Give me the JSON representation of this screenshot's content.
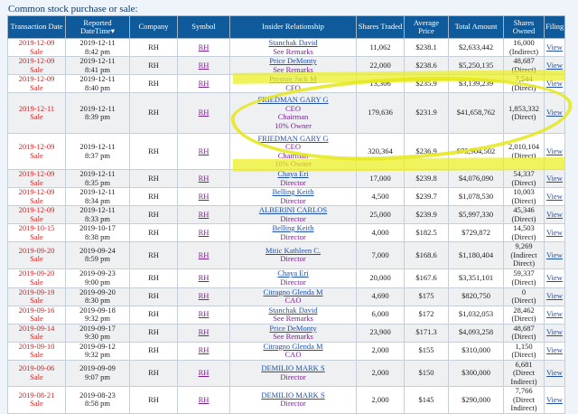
{
  "caption": "Common stock purchase or sale:",
  "headers": [
    "Transaction Date",
    "Reported DateTime▾",
    "Company",
    "Symbol",
    "Insider Relationship",
    "Shares Traded",
    "Average Price",
    "Total Amount",
    "Shares Owned",
    "Filing"
  ],
  "rows": [
    {
      "tdate": "2019-12-09",
      "ttype": "Sale",
      "rdate": "2019-12-11",
      "rtime": "8:42 pm",
      "company": "RH",
      "symbol": "RH",
      "insider": "Stanchak David",
      "roles": [
        "See Remarks"
      ],
      "shares": "11,062",
      "price": "$238.1",
      "total": "$2,633,442",
      "owned": [
        "16,000",
        "(Indirect)"
      ],
      "filing": "View"
    },
    {
      "tdate": "2019-12-09",
      "ttype": "Sale",
      "rdate": "2019-12-11",
      "rtime": "8:41 pm",
      "company": "RH",
      "symbol": "RH",
      "insider": "Price DeMonty",
      "roles": [
        "See Remarks"
      ],
      "shares": "22,000",
      "price": "$238.6",
      "total": "$5,250,135",
      "owned": [
        "48,687",
        "(Direct)"
      ],
      "filing": "View"
    },
    {
      "tdate": "2019-12-09",
      "ttype": "Sale",
      "rdate": "2019-12-11",
      "rtime": "8:40 pm",
      "company": "RH",
      "symbol": "RH",
      "insider": "Preston Jack M",
      "roles": [
        "CFO"
      ],
      "shares": "13,306",
      "price": "$235.9",
      "total": "$3,139,239",
      "owned": [
        "7,544",
        "(Direct)"
      ],
      "filing": "View"
    },
    {
      "tdate": "2019-12-11",
      "ttype": "Sale",
      "rdate": "2019-12-11",
      "rtime": "8:39 pm",
      "company": "RH",
      "symbol": "RH",
      "insider": "FRIEDMAN GARY G",
      "roles": [
        "CEO",
        "Chairman",
        "10% Owner"
      ],
      "shares": "179,636",
      "price": "$231.9",
      "total": "$41,658,762",
      "owned": [
        "1,853,332",
        "(Direct)"
      ],
      "filing": "View"
    },
    {
      "tdate": "2019-12-09",
      "ttype": "Sale",
      "rdate": "2019-12-11",
      "rtime": "8:37 pm",
      "company": "RH",
      "symbol": "RH",
      "insider": "FRIEDMAN GARY G",
      "roles": [
        "CEO",
        "Chairman",
        "10% Owner"
      ],
      "shares": "320,364",
      "price": "$236.9",
      "total": "$75,904,502",
      "owned": [
        "2,010,104",
        "(Direct)"
      ],
      "filing": "View"
    },
    {
      "tdate": "2019-12-09",
      "ttype": "Sale",
      "rdate": "2019-12-11",
      "rtime": "8:35 pm",
      "company": "RH",
      "symbol": "RH",
      "insider": "Chaya Eri",
      "roles": [
        "Director"
      ],
      "shares": "17,000",
      "price": "$239.8",
      "total": "$4,076,090",
      "owned": [
        "54,337",
        "(Direct)"
      ],
      "filing": "View"
    },
    {
      "tdate": "2019-12-09",
      "ttype": "Sale",
      "rdate": "2019-12-11",
      "rtime": "8:34 pm",
      "company": "RH",
      "symbol": "RH",
      "insider": "Belling Keith",
      "roles": [
        "Director"
      ],
      "shares": "4,500",
      "price": "$239.7",
      "total": "$1,078,530",
      "owned": [
        "10,003",
        "(Direct)"
      ],
      "filing": "View"
    },
    {
      "tdate": "2019-12-09",
      "ttype": "Sale",
      "rdate": "2019-12-11",
      "rtime": "8:33 pm",
      "company": "RH",
      "symbol": "RH",
      "insider": "ALBERINI CARLOS",
      "roles": [
        "Director"
      ],
      "shares": "25,000",
      "price": "$239.9",
      "total": "$5,997,330",
      "owned": [
        "45,346",
        "(Direct)"
      ],
      "filing": "View"
    },
    {
      "tdate": "2019-10-15",
      "ttype": "Sale",
      "rdate": "2019-10-17",
      "rtime": "8:38 pm",
      "company": "RH",
      "symbol": "RH",
      "insider": "Belling Keith",
      "roles": [
        "Director"
      ],
      "shares": "4,000",
      "price": "$182.5",
      "total": "$729,872",
      "owned": [
        "14,503",
        "(Direct)"
      ],
      "filing": "View"
    },
    {
      "tdate": "2019-09-20",
      "ttype": "Sale",
      "rdate": "2019-09-24",
      "rtime": "8:59 pm",
      "company": "RH",
      "symbol": "RH",
      "insider": "Mitic Kathleen C.",
      "roles": [
        "Director"
      ],
      "shares": "7,000",
      "price": "$168.6",
      "total": "$1,180,404",
      "owned": [
        "9,269",
        "(Indirect",
        "Direct)"
      ],
      "filing": "View"
    },
    {
      "tdate": "2019-09-20",
      "ttype": "Sale",
      "rdate": "2019-09-23",
      "rtime": "9:00 pm",
      "company": "RH",
      "symbol": "RH",
      "insider": "Chaya Eri",
      "roles": [
        "Director"
      ],
      "shares": "20,000",
      "price": "$167.6",
      "total": "$3,351,101",
      "owned": [
        "59,337",
        "(Direct)"
      ],
      "filing": "View"
    },
    {
      "tdate": "2019-09-19",
      "ttype": "Sale",
      "rdate": "2019-09-20",
      "rtime": "8:30 pm",
      "company": "RH",
      "symbol": "RH",
      "insider": "Citragno Glenda M",
      "roles": [
        "CAO"
      ],
      "shares": "4,690",
      "price": "$175",
      "total": "$820,750",
      "owned": [
        "0",
        "(Direct)"
      ],
      "filing": "View"
    },
    {
      "tdate": "2019-09-16",
      "ttype": "Sale",
      "rdate": "2019-09-18",
      "rtime": "9:32 pm",
      "company": "RH",
      "symbol": "RH",
      "insider": "Stanchak David",
      "roles": [
        "See Remarks"
      ],
      "shares": "6,000",
      "price": "$172",
      "total": "$1,032,053",
      "owned": [
        "28,462",
        "(Direct)"
      ],
      "filing": "View"
    },
    {
      "tdate": "2019-09-14",
      "ttype": "Sale",
      "rdate": "2019-09-17",
      "rtime": "9:30 pm",
      "company": "RH",
      "symbol": "RH",
      "insider": "Price DeMonty",
      "roles": [
        "See Remarks"
      ],
      "shares": "23,900",
      "price": "$171.3",
      "total": "$4,093,258",
      "owned": [
        "48,687",
        "(Direct)"
      ],
      "filing": "View"
    },
    {
      "tdate": "2019-09-10",
      "ttype": "Sale",
      "rdate": "2019-09-12",
      "rtime": "9:32 pm",
      "company": "RH",
      "symbol": "RH",
      "insider": "Citragno Glenda M",
      "roles": [
        "CAO"
      ],
      "shares": "2,000",
      "price": "$155",
      "total": "$310,000",
      "owned": [
        "1,150",
        "(Direct)"
      ],
      "filing": "View"
    },
    {
      "tdate": "2019-09-06",
      "ttype": "Sale",
      "rdate": "2019-09-09",
      "rtime": "9:07 pm",
      "company": "RH",
      "symbol": "RH",
      "insider": "DEMILIO MARK S",
      "roles": [
        "Director"
      ],
      "shares": "2,000",
      "price": "$150",
      "total": "$300,000",
      "owned": [
        "6,681",
        "(Direct",
        "Indirect)"
      ],
      "filing": "View"
    },
    {
      "tdate": "2019-08-21",
      "ttype": "Sale",
      "rdate": "2019-08-23",
      "rtime": "8:58 pm",
      "company": "RH",
      "symbol": "RH",
      "insider": "DEMILIO MARK S",
      "roles": [
        "Director"
      ],
      "shares": "2,000",
      "price": "$145",
      "total": "$290,000",
      "owned": [
        "7,766",
        "(Direct",
        "Indirect)"
      ],
      "filing": "View"
    }
  ]
}
